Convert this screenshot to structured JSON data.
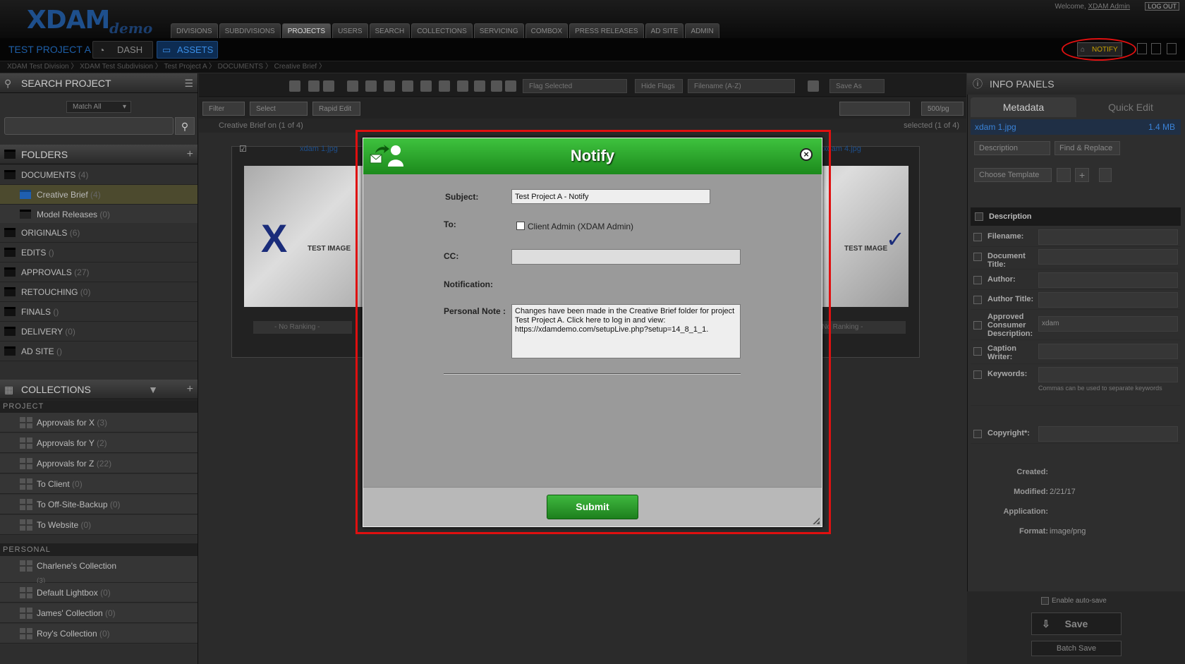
{
  "app": {
    "logo": "XDAM",
    "logo_sub": "demo",
    "welcome": "Welcome,",
    "user": "XDAM Admin",
    "logout": "LOG OUT"
  },
  "nav": [
    "DIVISIONS",
    "SUBDIVISIONS",
    "PROJECTS",
    "USERS",
    "SEARCH",
    "COLLECTIONS",
    "SERVICING",
    "COMBOX",
    "PRESS RELEASES",
    "AD SITE",
    "ADMIN"
  ],
  "project": {
    "title": "TEST PROJECT A",
    "dash": "DASH",
    "assets": "ASSETS",
    "notify": "NOTIFY"
  },
  "breadcrumb": "XDAM Test Division 〉 XDAM Test Subdivision 〉 Test Project A 〉 DOCUMENTS 〉 Creative Brief 〉",
  "left": {
    "search_header": "SEARCH PROJECT",
    "match": "Match All",
    "folders_header": "FOLDERS",
    "folders": [
      {
        "name": "DOCUMENTS",
        "count": "(4)"
      },
      {
        "name": "Creative Brief",
        "count": "(4)"
      },
      {
        "name": "Model Releases",
        "count": "(0)"
      },
      {
        "name": "ORIGINALS",
        "count": "(6)"
      },
      {
        "name": "EDITS",
        "count": "()"
      },
      {
        "name": "APPROVALS",
        "count": "(27)"
      },
      {
        "name": "RETOUCHING",
        "count": "(0)"
      },
      {
        "name": "FINALS",
        "count": "()"
      },
      {
        "name": "DELIVERY",
        "count": "(0)"
      },
      {
        "name": "AD SITE",
        "count": "()"
      }
    ],
    "collections_header": "COLLECTIONS",
    "project_label": "PROJECT",
    "project_collections": [
      {
        "name": "Approvals for X",
        "count": "(3)"
      },
      {
        "name": "Approvals for Y",
        "count": "(2)"
      },
      {
        "name": "Approvals for Z",
        "count": "(22)"
      },
      {
        "name": "To Client",
        "count": "(0)"
      },
      {
        "name": "To Off-Site-Backup",
        "count": "(0)"
      },
      {
        "name": "To Website",
        "count": "(0)"
      }
    ],
    "personal_label": "PERSONAL",
    "personal_collections": [
      {
        "name": "Charlene's Collection",
        "count": "(3)"
      },
      {
        "name": "Default Lightbox",
        "count": "(0)"
      },
      {
        "name": "James' Collection",
        "count": "(0)"
      },
      {
        "name": "Roy's Collection",
        "count": "(0)"
      }
    ]
  },
  "toolbar": {
    "flag": "Flag Selected",
    "hide_flags": "Hide Flags",
    "sort": "Filename (A-Z)",
    "save_as": "Save As",
    "filter": "Filter",
    "select": "Select",
    "rapid_edit": "Rapid Edit",
    "per_page": "500/pg"
  },
  "path": {
    "folder": "Creative Brief",
    "count": "on (1 of 4)",
    "selected": "selected (1 of 4)"
  },
  "thumbs": [
    {
      "name": "xdam 1.jpg",
      "text": "TEST IMAGE",
      "ranking": "- No Ranking -"
    },
    {
      "name": "xdam 4.jpg",
      "text": "TEST IMAGE",
      "ranking": "- No Ranking -"
    }
  ],
  "right": {
    "header": "INFO PANELS",
    "tab_meta": "Metadata",
    "tab_quick": "Quick Edit",
    "filename": "xdam 1.jpg",
    "filesize": "1.4 MB",
    "description_dd": "Description",
    "find_replace": "Find & Replace",
    "choose_template": "Choose Template",
    "section": "Description",
    "fields": [
      {
        "label": "Filename:",
        "value": ""
      },
      {
        "label": "Document Title:",
        "value": ""
      },
      {
        "label": "Author:",
        "value": ""
      },
      {
        "label": "Author Title:",
        "value": ""
      },
      {
        "label": "Approved Consumer Description:",
        "value": "xdam"
      },
      {
        "label": "Caption Writer:",
        "value": ""
      },
      {
        "label": "Keywords:",
        "value": ""
      }
    ],
    "keywords_hint": "Commas can be used to separate keywords",
    "copyright": "Copyright*:",
    "created_label": "Created:",
    "created": "",
    "modified_label": "Modified:",
    "modified": "2/21/17",
    "application_label": "Application:",
    "application": "",
    "format_label": "Format:",
    "format": "image/png",
    "autosave": "Enable auto-save",
    "save": "Save",
    "batch_save": "Batch Save"
  },
  "modal": {
    "title": "Notify",
    "subject_label": "Subject:",
    "subject_value": "Test Project A - Notify",
    "to_label": "To:",
    "to_option": "Client Admin (XDAM Admin)",
    "cc_label": "CC:",
    "notification_label": "Notification:",
    "note_label": "Personal Note :",
    "note_value": "Changes have been made in the Creative Brief folder for project Test Project A. Click here to log in and view: https://xdamdemo.com/setupLive.php?setup=14_8_1_1.",
    "submit": "Submit"
  },
  "colors": {
    "accent_green": "#2aa32a",
    "highlight_red": "#e01010",
    "brand_blue": "#1e4f8c",
    "notify_gold": "#c8a100"
  }
}
